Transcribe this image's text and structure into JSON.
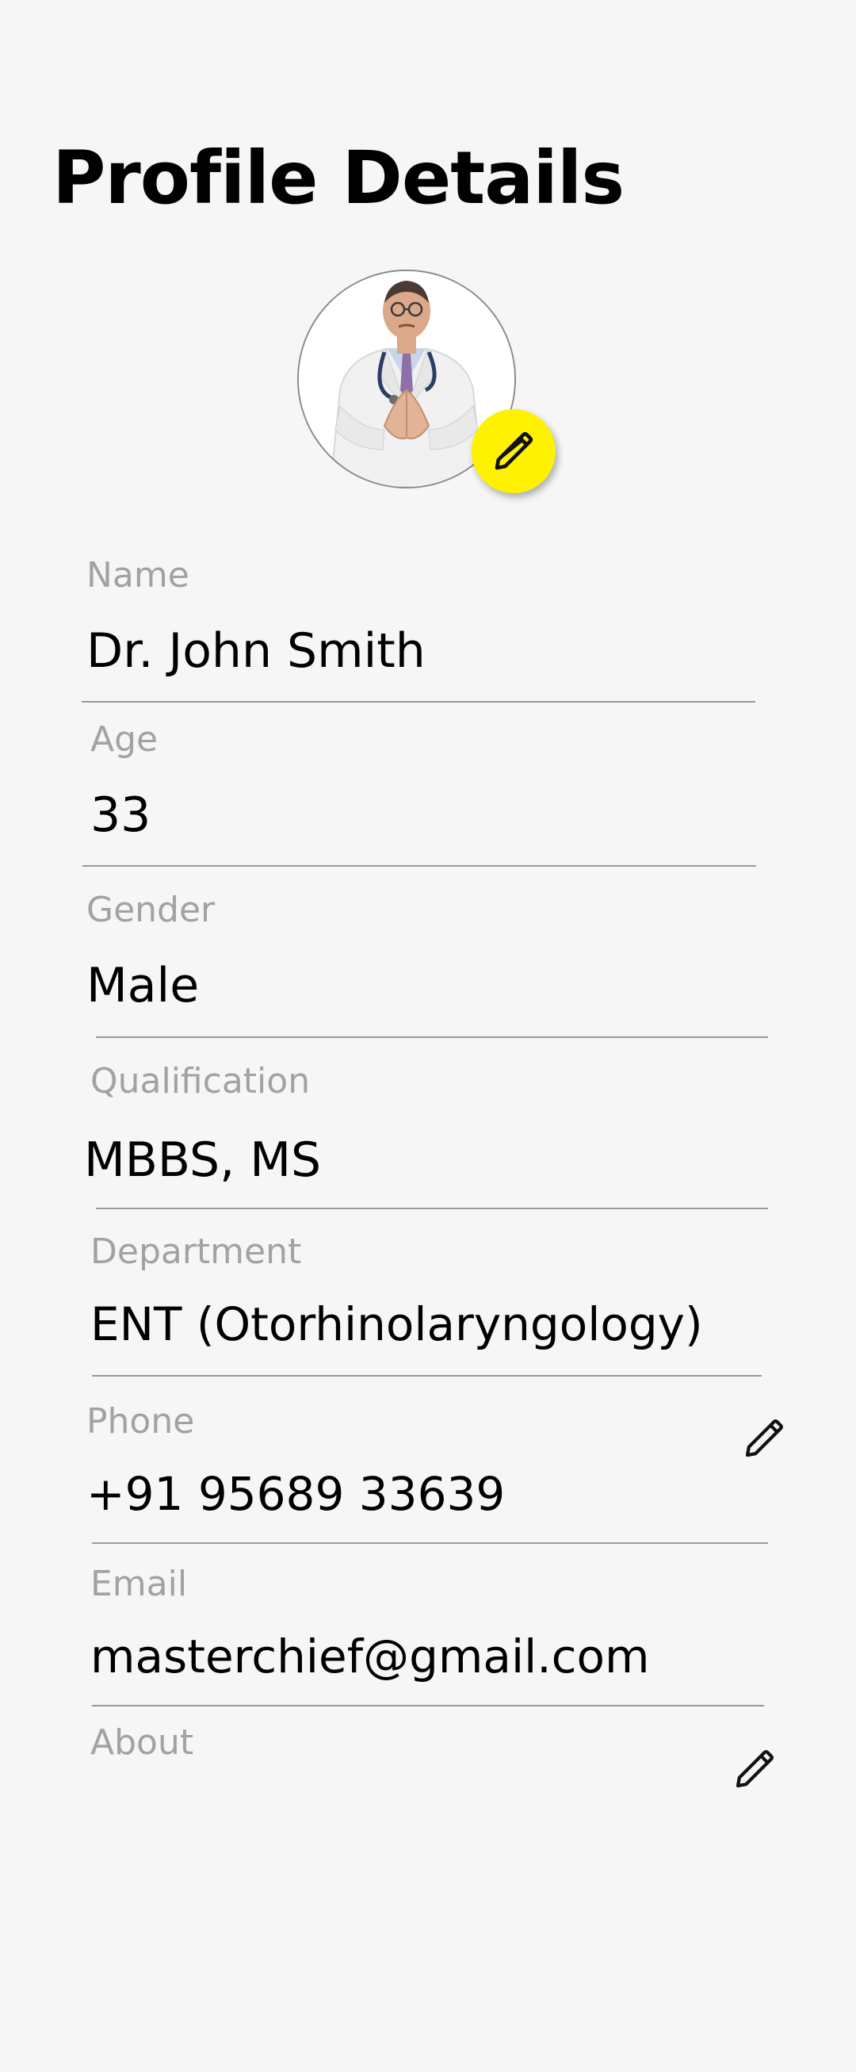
{
  "header": {
    "title": "Profile Details"
  },
  "avatar": {
    "edit_icon": "pencil-icon"
  },
  "fields": {
    "name": {
      "label": "Name",
      "value": "Dr. John Smith"
    },
    "age": {
      "label": "Age",
      "value": "33"
    },
    "gender": {
      "label": "Gender",
      "value": "Male"
    },
    "qualification": {
      "label": "Qualification",
      "value": "MBBS, MS"
    },
    "department": {
      "label": "Department",
      "value": "ENT (Otorhinolaryngology)"
    },
    "phone": {
      "label": "Phone",
      "value": "+91 95689 33639",
      "edit_icon": "pencil-icon"
    },
    "email": {
      "label": "Email",
      "value": "masterchief@gmail.com"
    },
    "about": {
      "label": "About",
      "value": "",
      "edit_icon": "pencil-icon"
    }
  },
  "colors": {
    "background": "#f6f6f6",
    "edit_button": "#fff200",
    "label": "#a2a2a2",
    "divider": "#9a9a9a"
  }
}
